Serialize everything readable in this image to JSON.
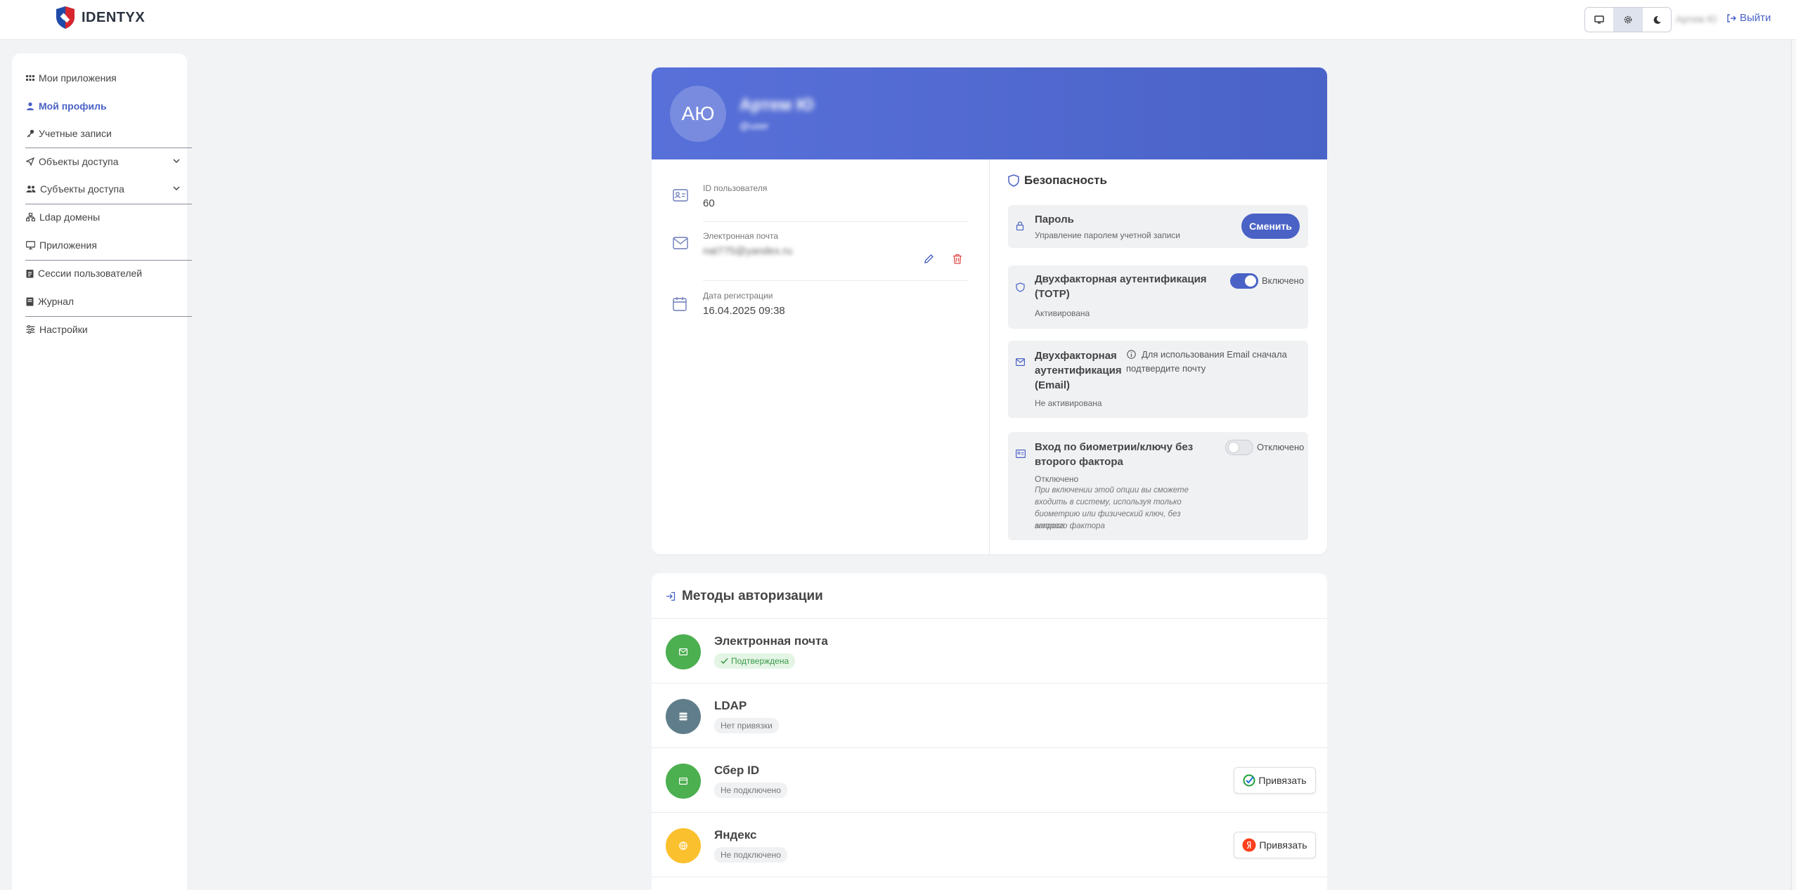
{
  "header": {
    "brand": "IDENTYX",
    "user_name": "Артем Ю",
    "logout_label": "Выйти",
    "theme_options": [
      "desktop-icon",
      "gear-icon",
      "moon-icon"
    ],
    "active_theme": "gear-icon"
  },
  "sidebar": {
    "items": [
      {
        "label": "Мои приложения",
        "icon": "grid-icon"
      },
      {
        "label": "Мой профиль",
        "icon": "user-icon",
        "active": true
      },
      {
        "label": "Учетные записи",
        "icon": "key-icon"
      },
      {
        "label": "Объекты доступа",
        "icon": "send-icon",
        "expandable": true
      },
      {
        "label": "Субъекты доступа",
        "icon": "users-icon",
        "expandable": true
      },
      {
        "label": "Ldap домены",
        "icon": "network-icon"
      },
      {
        "label": "Приложения",
        "icon": "monitor-icon"
      },
      {
        "label": "Сессии пользователей",
        "icon": "clipboard-icon"
      },
      {
        "label": "Журнал",
        "icon": "book-icon"
      },
      {
        "label": "Настройки",
        "icon": "sliders-icon"
      }
    ]
  },
  "profile": {
    "initials": "АЮ",
    "name": "Артем Ю",
    "login": "@user",
    "fields": {
      "id_label": "ID пользователя",
      "id_value": "60",
      "email_label": "Электронная почта",
      "email_value": "nat775@yandex.ru",
      "reg_label": "Дата регистрации",
      "reg_value": "16.04.2025 09:38"
    }
  },
  "security": {
    "title": "Безопасность",
    "password": {
      "title": "Пароль",
      "subtitle": "Управление паролем учетной записи",
      "button": "Сменить"
    },
    "totp": {
      "title_line1": "Двухфакторная аутентификация",
      "title_line2": "(TOTP)",
      "status": "Активирована",
      "toggle_label": "Включено",
      "enabled": true
    },
    "email2fa": {
      "title_line1": "Двухфакторная",
      "title_line2": "аутентификация",
      "title_line3": "(Email)",
      "status": "Не активирована",
      "hint_line1": "Для использования Email сначала",
      "hint_line2": "подтвердите почту"
    },
    "biometric": {
      "title_line1": "Вход по биометрии/ключу без",
      "title_line2": "второго фактора",
      "status": "Отключено",
      "toggle_label": "Отключено",
      "enabled": false,
      "note_line1": "При включении этой опции вы сможете",
      "note_line2": "входить в систему, используя только",
      "note_line3": "биометрию или физический ключ, без запроса",
      "note_line4": "второго фактора"
    }
  },
  "auth_methods": {
    "title": "Методы авторизации",
    "items": [
      {
        "name": "Электронная почта",
        "status": "Подтверждена",
        "color": "#4caf50",
        "icon": "mail-icon"
      },
      {
        "name": "LDAP",
        "status": "Нет привязки",
        "color": "#607d8b",
        "icon": "server-icon"
      },
      {
        "name": "Сбер ID",
        "status": "Не подключено",
        "color": "#4caf50",
        "icon": "card-icon",
        "button": "Привязать"
      },
      {
        "name": "Яндекс",
        "status": "Не подключено",
        "color": "#fbc02d",
        "icon": "globe-icon",
        "button": "Привязать"
      }
    ]
  },
  "colors": {
    "accent": "#4a62c6",
    "sidebar_bg": "#ffffff",
    "page_bg": "#f1f3f5"
  }
}
